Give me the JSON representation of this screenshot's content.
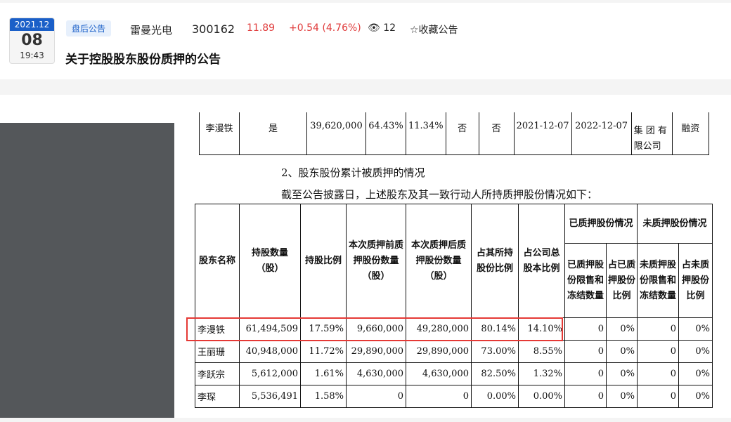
{
  "header": {
    "date_ym": "2021.12",
    "date_day": "08",
    "time": "19:43",
    "tag": "盘后公告",
    "stock_name": "雷曼光电",
    "stock_code": "300162",
    "price": "11.89",
    "change": "+0.54 (4.76%)",
    "views": "12",
    "favorite": "☆收藏公告",
    "title": "关于控股股东股份质押的公告"
  },
  "prev_table": {
    "cells": [
      "李漫铁",
      "是",
      "39,620,000",
      "64.43%",
      "11.34%",
      "否",
      "否",
      "2021-12-07",
      "2022-12-07",
      "集 团 有\n限公司",
      "融资"
    ]
  },
  "section": {
    "heading": "2、股东股份累计被质押的情况",
    "intro": "截至公告披露日，上述股东及其一致行动人所持质押股份情况如下："
  },
  "table": {
    "headers": [
      "股东名称",
      "持股数量（股）",
      "持股比例",
      "本次质押前质押股份数量（股）",
      "本次质押后质押股份数量（股）",
      "占其所持股份比例",
      "占公司总股本比例"
    ],
    "group_pledged": "已质押股份情况",
    "group_unpledged": "未质押股份情况",
    "sub_headers": [
      "已质押股份限售和冻结数量",
      "占已质押股份比例",
      "未质押股份限售和冻结数量",
      "占未质押股份比例"
    ],
    "rows": [
      [
        "李漫铁",
        "61,494,509",
        "17.59%",
        "9,660,000",
        "49,280,000",
        "80.14%",
        "14.10%",
        "0",
        "0%",
        "0",
        "0%"
      ],
      [
        "王丽珊",
        "40,948,000",
        "11.72%",
        "29,890,000",
        "29,890,000",
        "73.00%",
        "8.55%",
        "0",
        "0%",
        "0",
        "0%"
      ],
      [
        "李跃宗",
        "5,612,000",
        "1.61%",
        "4,630,000",
        "4,630,000",
        "82.50%",
        "1.32%",
        "0",
        "0%",
        "0",
        "0%"
      ],
      [
        "李琛",
        "5,536,491",
        "1.58%",
        "0",
        "0",
        "0.00%",
        "0.00%",
        "0",
        "0%",
        "0",
        "0%"
      ]
    ]
  }
}
